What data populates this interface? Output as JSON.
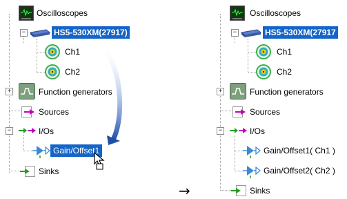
{
  "left": {
    "oscilloscopes": "Oscilloscopes",
    "device": "HS5-530XM(27917)",
    "ch1": "Ch1",
    "ch2": "Ch2",
    "function_generators": "Function generators",
    "sources": "Sources",
    "ios": "I/Os",
    "gain_offset": "Gain/Offset1",
    "sinks": "Sinks"
  },
  "right": {
    "oscilloscopes": "Oscilloscopes",
    "device": "HS5-530XM(27917",
    "ch1": "Ch1",
    "ch2": "Ch2",
    "function_generators": "Function generators",
    "sources": "Sources",
    "ios": "I/Os",
    "gain_offset_1": "Gain/Offset1( Ch1 )",
    "gain_offset_2": "Gain/Offset2( Ch2 )",
    "sinks": "Sinks"
  },
  "transition_arrow": "→",
  "colors": {
    "selection": "#1565c8",
    "source_arrow": "#c000c0",
    "sink_arrow": "#20a020",
    "gain_icon": "#3a8ad8",
    "channel_ring": "#2bb0c8",
    "channel_core": "#f0d000"
  }
}
